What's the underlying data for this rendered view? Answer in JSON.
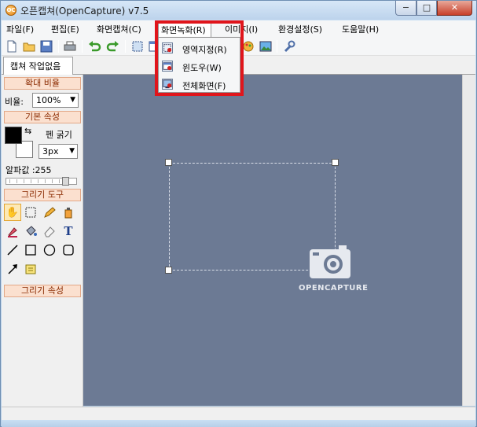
{
  "window": {
    "title": "오픈캡쳐(OpenCapture) v7.5",
    "app_icon_text": "OC",
    "min_label": "−",
    "max_label": "□",
    "close_label": "✕"
  },
  "menubar": {
    "items": [
      "파일(F)",
      "편집(E)",
      "화면캡쳐(C)",
      "화면녹화(R)",
      "이미지(I)",
      "환경설정(S)",
      "도움말(H)"
    ]
  },
  "dropdown": {
    "items": [
      "영역지정(R)",
      "윈도우(W)",
      "전체화면(F)"
    ]
  },
  "tab": {
    "label": "캡쳐 작업없음"
  },
  "left_panel": {
    "zoom_header": "확대 비율",
    "zoom_label": "비율:",
    "zoom_value": "100%",
    "basic_header": "기본 속성",
    "pen_label": "펜 굵기",
    "pen_value": "3px",
    "alpha_label": "알파값 :255",
    "tools_header": "그리기 도구",
    "draw_props_header": "그리기 속성"
  },
  "canvas": {
    "logo_text": "OPENCAPTURE"
  },
  "colors": {
    "canvas": "#6c7a94",
    "highlight": "#e0151b",
    "section_bg": "#fbe0cf"
  }
}
